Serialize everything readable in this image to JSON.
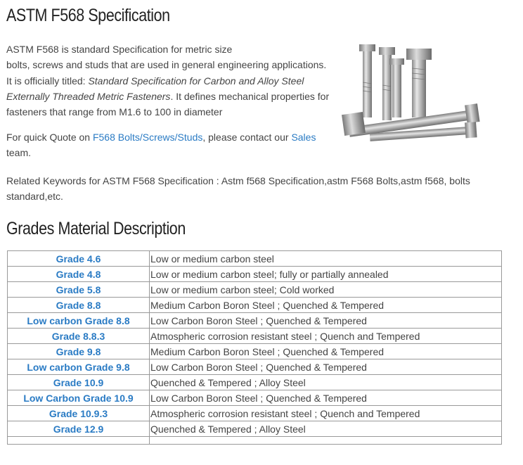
{
  "title": "ASTM F568 Specification",
  "intro": {
    "line1": "ASTM F568 is standard Specification for metric size",
    "line2": " bolts, screws and studs that are used in general engineering applications.",
    "line3_prefix": "It is officially titled: ",
    "line3_italic": "Standard Specification for Carbon and Alloy Steel",
    "line4_italic": "Externally Threaded Metric Fasteners",
    "line4_suffix": ". It defines mechanical properties for",
    "line5": "fasteners that range from M1.6 to 100 in diameter"
  },
  "quote": {
    "prefix": "For quick Quote on ",
    "link1": "F568 Bolts/Screws/Studs",
    "middle": ", please contact our ",
    "link2": "Sales",
    "suffix_line": "team."
  },
  "keywords": {
    "line1": "Related Keywords for ASTM F568 Specification : Astm f568 Specification,astm F568 Bolts,astm f568, bolts",
    "line2": "standard,etc."
  },
  "section_title": "Grades Material Description",
  "grades": [
    {
      "grade": "Grade 4.6",
      "desc": "Low or medium carbon steel"
    },
    {
      "grade": "Grade 4.8",
      "desc": "Low or medium carbon steel; fully or partially annealed"
    },
    {
      "grade": "Grade 5.8",
      "desc": "Low or medium carbon steel; Cold worked"
    },
    {
      "grade": "Grade 8.8",
      "desc": "Medium Carbon Boron Steel ; Quenched & Tempered"
    },
    {
      "grade": "Low carbon Grade 8.8",
      "desc": "Low Carbon Boron Steel ; Quenched & Tempered"
    },
    {
      "grade": "Grade 8.8.3",
      "desc": "Atmospheric corrosion resistant steel ; Quench and Tempered"
    },
    {
      "grade": "Grade 9.8",
      "desc": "Medium Carbon Boron Steel ; Quenched & Tempered"
    },
    {
      "grade": "Low carbon Grade 9.8",
      "desc": "Low Carbon Boron Steel ; Quenched & Tempered"
    },
    {
      "grade": "Grade 10.9",
      "desc": "Quenched & Tempered ; Alloy Steel"
    },
    {
      "grade": "Low Carbon Grade 10.9",
      "desc": "Low Carbon Boron Steel ; Quenched & Tempered"
    },
    {
      "grade": "Grade 10.9.3",
      "desc": "Atmospheric corrosion resistant steel ; Quench and Tempered"
    },
    {
      "grade": "Grade 12.9",
      "desc": "Quenched & Tempered ; Alloy Steel"
    }
  ],
  "colors": {
    "link": "#2a7bc4",
    "text": "#444444",
    "heading": "#222222",
    "border": "#999999"
  }
}
